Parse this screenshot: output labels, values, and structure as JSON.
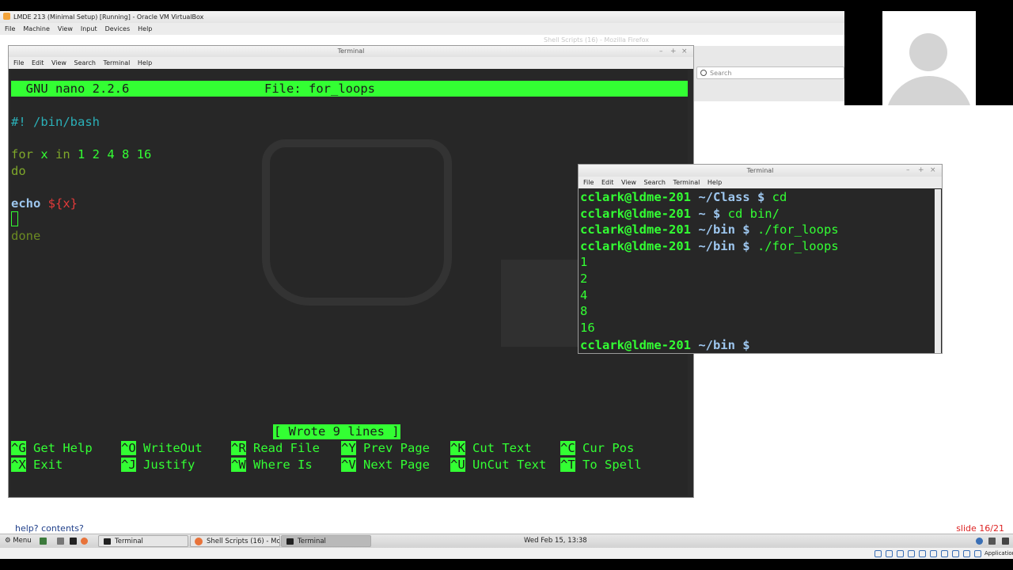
{
  "vbox": {
    "title": "LMDE 213 (Minimal Setup) [Running] - Oracle VM VirtualBox",
    "menu": [
      "File",
      "Machine",
      "View",
      "Input",
      "Devices",
      "Help"
    ]
  },
  "firefox": {
    "title": "Shell Scripts (16) - Mozilla Firefox",
    "search_placeholder": "Search"
  },
  "term1": {
    "title": "Terminal",
    "menu": [
      "File",
      "Edit",
      "View",
      "Search",
      "Terminal",
      "Help"
    ],
    "nano_version": "  GNU nano 2.2.6",
    "file_label": "File: for_loops",
    "code": {
      "shebang": "#! /bin/bash",
      "for_kw": "for",
      "for_var": " x ",
      "in_kw": "in",
      "for_list": " 1 2 4 8 16",
      "do": "do",
      "echo": "echo",
      "var": " ${x}",
      "done": "done"
    },
    "status": "[ Wrote 9 lines ]",
    "shortcuts": [
      {
        "key": "^G",
        "label": " Get Help"
      },
      {
        "key": "^O",
        "label": " WriteOut"
      },
      {
        "key": "^R",
        "label": " Read File"
      },
      {
        "key": "^Y",
        "label": " Prev Page"
      },
      {
        "key": "^K",
        "label": " Cut Text"
      },
      {
        "key": "^C",
        "label": " Cur Pos"
      },
      {
        "key": "^X",
        "label": " Exit"
      },
      {
        "key": "^J",
        "label": " Justify"
      },
      {
        "key": "^W",
        "label": " Where Is"
      },
      {
        "key": "^V",
        "label": " Next Page"
      },
      {
        "key": "^U",
        "label": " UnCut Text"
      },
      {
        "key": "^T",
        "label": " To Spell"
      }
    ]
  },
  "term2": {
    "title": "Terminal",
    "menu": [
      "File",
      "Edit",
      "View",
      "Search",
      "Terminal",
      "Help"
    ],
    "lines": [
      {
        "prompt": "cclark@ldme-201 ",
        "path": "~/Class $ ",
        "cmd": "cd"
      },
      {
        "prompt": "cclark@ldme-201 ",
        "path": "~ $ ",
        "cmd": "cd bin/"
      },
      {
        "prompt": "cclark@ldme-201 ",
        "path": "~/bin $ ",
        "cmd": "./for_loops"
      },
      {
        "prompt": "cclark@ldme-201 ",
        "path": "~/bin $ ",
        "cmd": "./for_loops"
      }
    ],
    "output": [
      "1",
      "2",
      "4",
      "8",
      "16"
    ],
    "last_prompt": "cclark@ldme-201 ",
    "last_path": "~/bin $ "
  },
  "footer": {
    "help": "help? contents?",
    "slide": "slide 16/21"
  },
  "taskbar": {
    "menu_label": "Menu",
    "windows": [
      "Terminal",
      "Shell Scripts (16) - Mo...",
      "Terminal"
    ],
    "clock": "Wed Feb 15, 13:38",
    "tray_label": "Application"
  }
}
